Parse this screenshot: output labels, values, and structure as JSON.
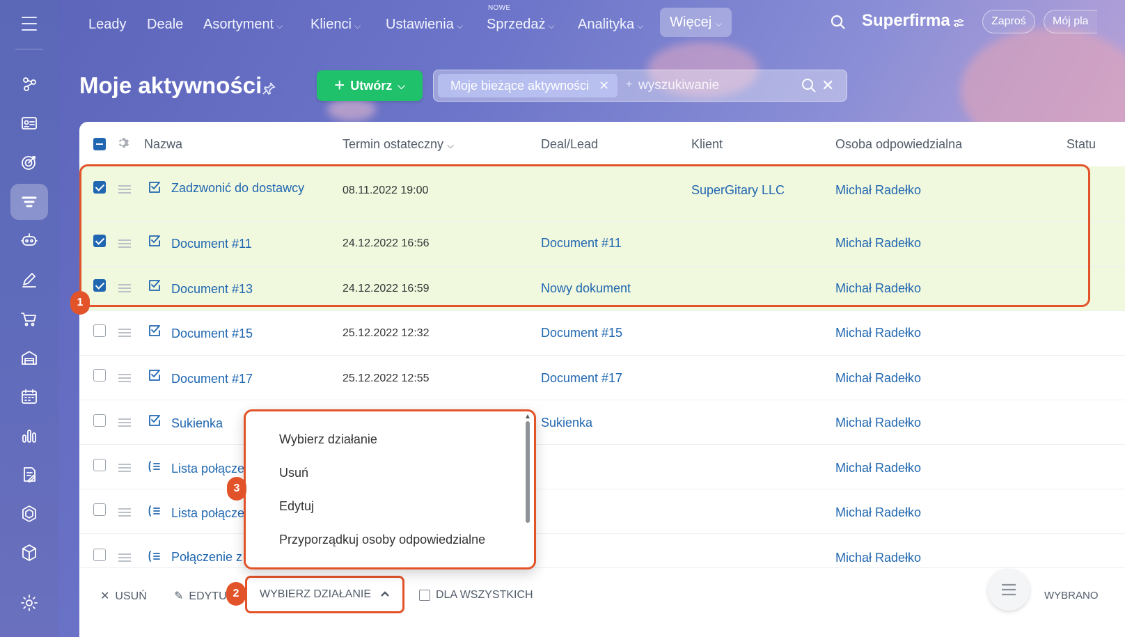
{
  "topnav": {
    "items": [
      {
        "label": "Leady",
        "dropdown": false
      },
      {
        "label": "Deale",
        "dropdown": false
      },
      {
        "label": "Asortyment",
        "dropdown": true
      },
      {
        "label": "Klienci",
        "dropdown": true
      },
      {
        "label": "Ustawienia",
        "dropdown": true
      },
      {
        "label": "Sprzedaż",
        "dropdown": true,
        "badge": "NOWE"
      },
      {
        "label": "Analityka",
        "dropdown": true
      }
    ],
    "more_label": "Więcej",
    "brand": "Superfirma",
    "invite_label": "Zaproś",
    "plan_label": "Mój pla"
  },
  "page": {
    "title": "Moje aktywności",
    "create_label": "Utwórz",
    "filter_tag": "Moje bieżące aktywności",
    "search_placeholder": "wyszukiwanie"
  },
  "grid": {
    "columns": {
      "name": "Nazwa",
      "deadline": "Termin ostateczny",
      "deal": "Deal/Lead",
      "client": "Klient",
      "responsible": "Osoba odpowiedzialna",
      "status": "Statu"
    },
    "rows": [
      {
        "name": "Zadzwonić do dostawcy",
        "type": "task",
        "deadline": "08.11.2022 19:00",
        "deal": "",
        "client": "SuperGitary LLC",
        "responsible": "Michał Radełko",
        "checked": true
      },
      {
        "name": "Document #11",
        "type": "task",
        "deadline": "24.12.2022 16:56",
        "deal": "Document #11",
        "client": "",
        "responsible": "Michał Radełko",
        "checked": true
      },
      {
        "name": "Document #13",
        "type": "task",
        "deadline": "24.12.2022 16:59",
        "deal": "Nowy dokument",
        "client": "",
        "responsible": "Michał Radełko",
        "checked": true
      },
      {
        "name": "Document #15",
        "type": "task",
        "deadline": "25.12.2022 12:32",
        "deal": "Document #15",
        "client": "",
        "responsible": "Michał Radełko",
        "checked": false
      },
      {
        "name": "Document #17",
        "type": "task",
        "deadline": "25.12.2022 12:55",
        "deal": "Document #17",
        "client": "",
        "responsible": "Michał Radełko",
        "checked": false
      },
      {
        "name": "Sukienka",
        "type": "task",
        "deadline": "",
        "deal": "Sukienka",
        "client": "",
        "responsible": "Michał Radełko",
        "checked": false
      },
      {
        "name": "Lista połącze",
        "type": "call-list",
        "deadline": "",
        "deal": "",
        "client": "",
        "responsible": "Michał Radełko",
        "checked": false
      },
      {
        "name": "Lista połącze",
        "type": "call-list",
        "deadline": "",
        "deal": "",
        "client": "",
        "responsible": "Michał Radełko",
        "checked": false
      },
      {
        "name": "Połączenie z",
        "type": "call-list",
        "deadline": "",
        "deal": "",
        "client": "",
        "responsible": "Michał Radełko",
        "checked": false
      }
    ]
  },
  "dropdown": {
    "options": [
      "Wybierz działanie",
      "Usuń",
      "Edytuj",
      "Przyporządkuj osoby odpowiedzialne"
    ]
  },
  "footer": {
    "delete_label": "USUŃ",
    "edit_label": "EDYTU",
    "action_label": "WYBIERZ DZIAŁANIE",
    "for_all_label": "DLA WSZYSTKICH",
    "selected_label": "WYBRANO"
  },
  "markers": [
    "1",
    "2",
    "3"
  ],
  "colors": {
    "accent_link": "#2067b0",
    "create_green": "#1fc16b",
    "highlight_red": "#e2532a",
    "selected_row_bg": "#f0f8de"
  },
  "sidebar_icons": [
    "menu-icon",
    "contacts-icon",
    "id-card-icon",
    "target-icon",
    "funnel-icon",
    "robot-icon",
    "pen-icon",
    "cart-icon",
    "warehouse-icon",
    "calendar-icon",
    "chart-icon",
    "document-icon",
    "hexagon-icon",
    "cube-icon",
    "gear-icon"
  ]
}
